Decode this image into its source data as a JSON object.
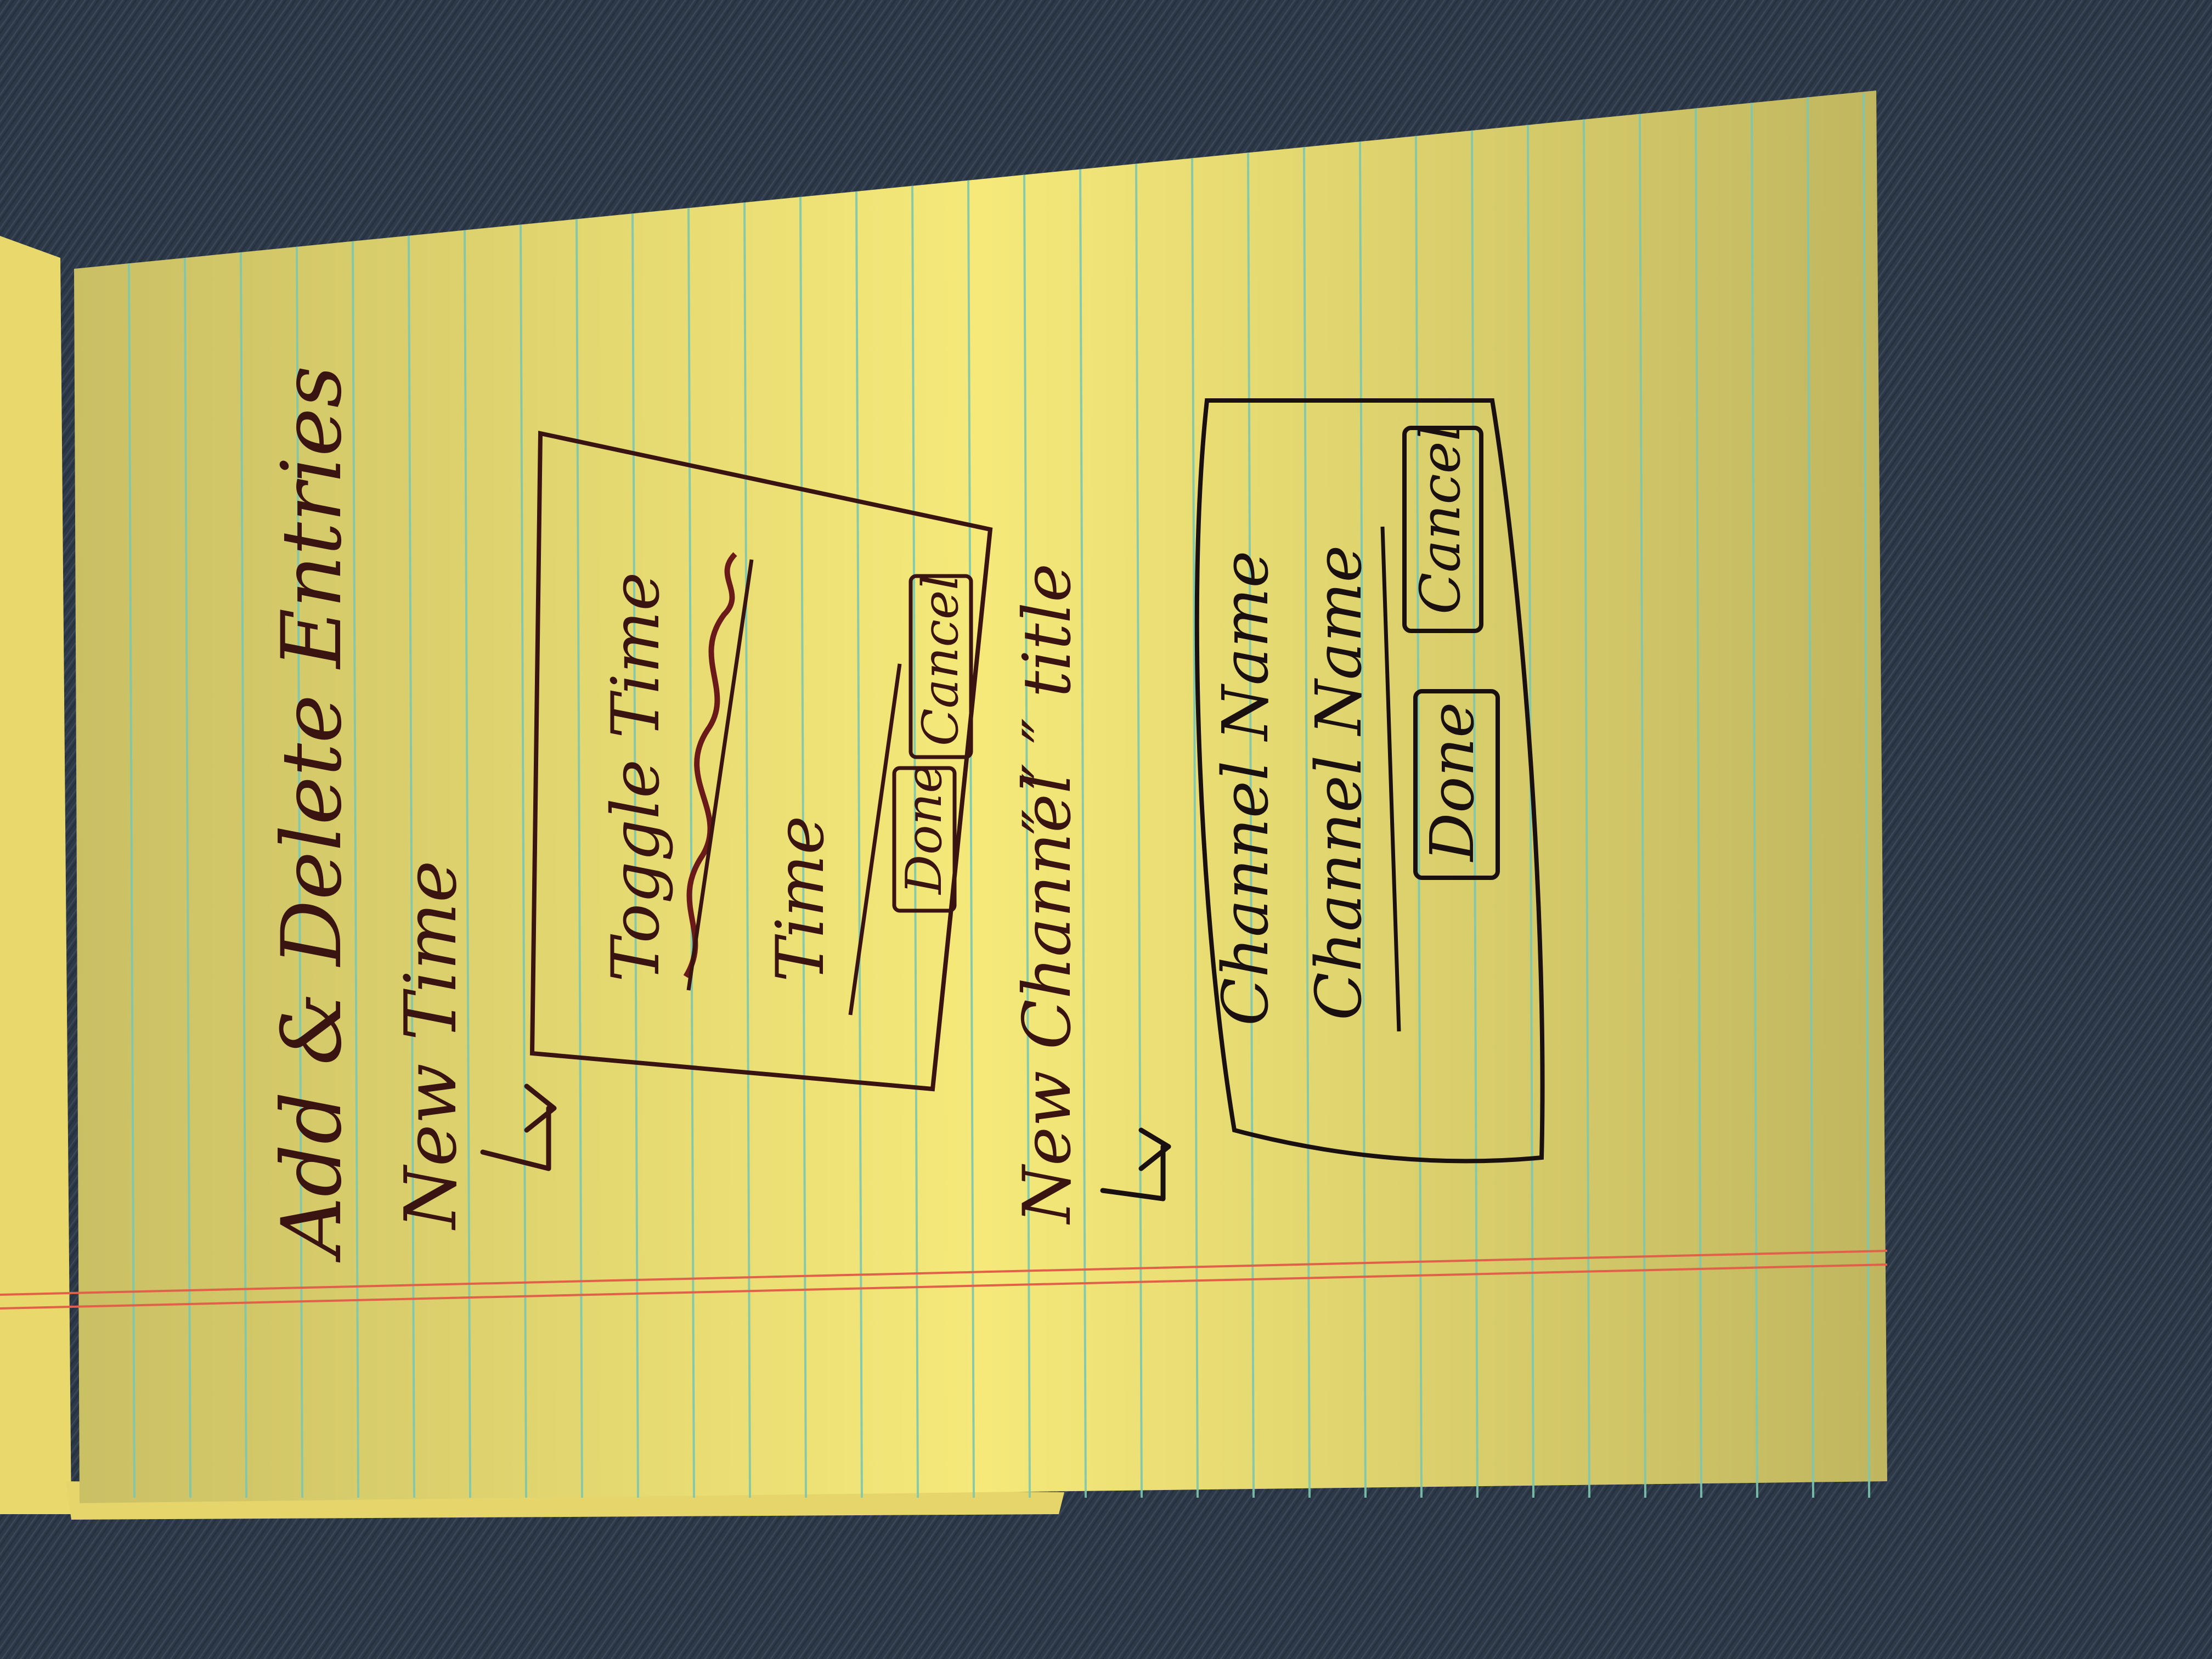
{
  "title": "Add & Delete Entries",
  "section_time": {
    "heading": "New Time",
    "dialog": {
      "struck_label": "Toggle Time",
      "field_label": "Time",
      "done_label": "Done",
      "cancel_label": "Cancel"
    }
  },
  "section_channel": {
    "heading": "New Channel",
    "heading_note": "″ ″ ″ title",
    "dialog": {
      "title_label": "Channel Name",
      "field_label": "Channel Name",
      "done_label": "Done",
      "cancel_label": "Cancel"
    }
  },
  "colors": {
    "paper": "#f6e97a",
    "rule_line": "#7cc7b0",
    "margin_line": "#e0604a",
    "ink": "#3a1410",
    "ink_black": "#1a1010",
    "fabric": "#2f3a4a"
  }
}
